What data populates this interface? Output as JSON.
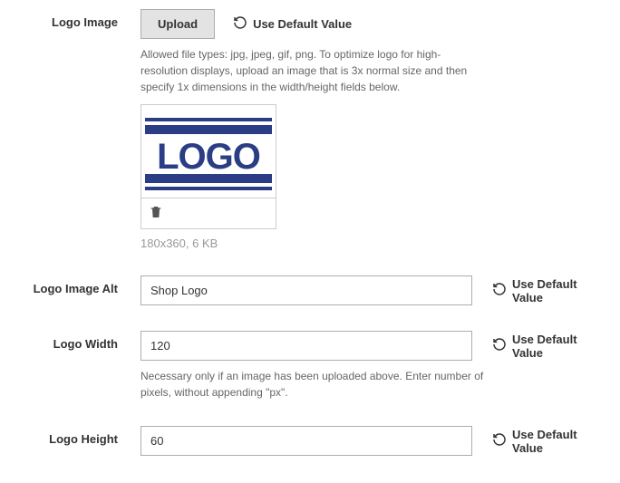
{
  "labels": {
    "logo_image": "Logo Image",
    "logo_image_alt": "Logo Image Alt",
    "logo_width": "Logo Width",
    "logo_height": "Logo Height"
  },
  "upload_btn": "Upload",
  "use_default": "Use Default Value",
  "help": {
    "logo_image": "Allowed file types: jpg, jpeg, gif, png. To optimize logo for high-resolution displays, upload an image that is 3x normal size and then specify 1x dimensions in the width/height fields below.",
    "logo_width": "Necessary only if an image has been uploaded above. Enter number of pixels, without appending \"px\"."
  },
  "preview": {
    "text": "LOGO",
    "meta": "180x360, 6 KB",
    "accent": "#2a3d85"
  },
  "values": {
    "logo_image_alt": "Shop Logo",
    "logo_width": "120",
    "logo_height": "60"
  }
}
